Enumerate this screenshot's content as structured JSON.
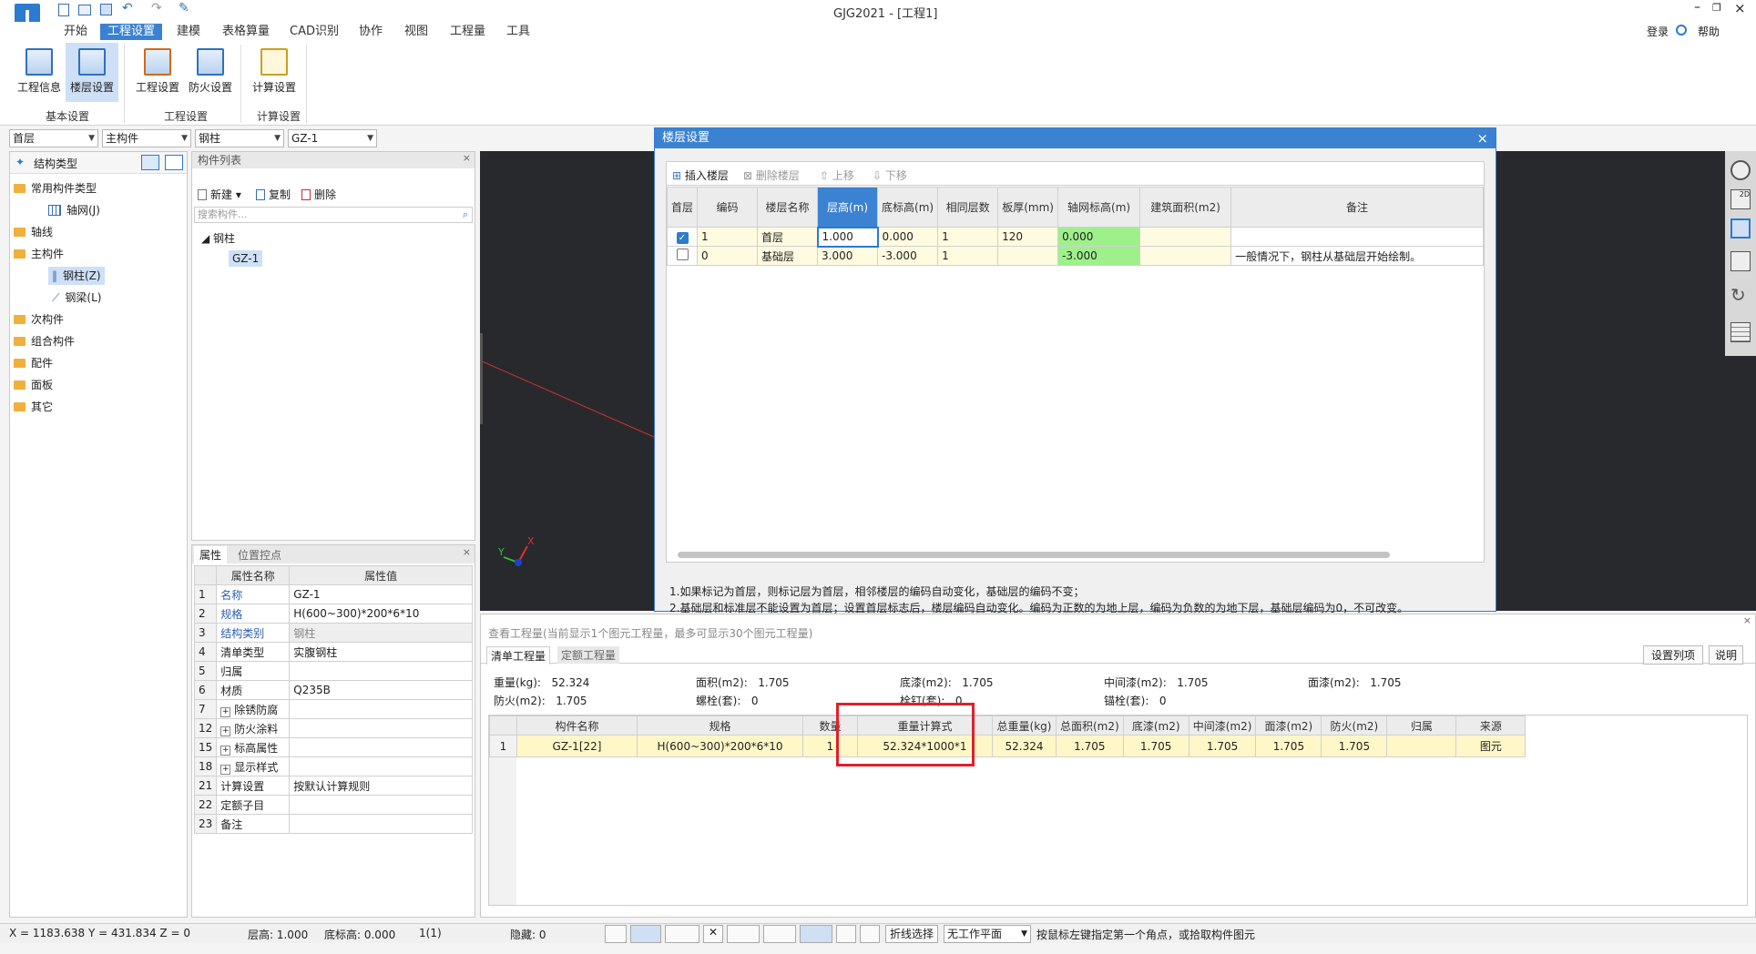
{
  "app": {
    "title": "GJG2021 - [工程1]",
    "login": "登录",
    "help": "帮助"
  },
  "menu": [
    "开始",
    "工程设置",
    "建模",
    "表格算量",
    "CAD识别",
    "协作",
    "视图",
    "工程量",
    "工具"
  ],
  "ribbon": {
    "buttons": [
      "工程信息",
      "楼层设置",
      "工程设置",
      "防火设置",
      "计算设置"
    ],
    "groups": [
      "基本设置",
      "工程设置",
      "计算设置"
    ]
  },
  "selectors": [
    "首层",
    "主构件",
    "钢柱",
    "GZ-1"
  ],
  "structure_panel": {
    "title": "结构类型",
    "items": [
      "常用构件类型",
      "轴网(J)",
      "轴线",
      "主构件",
      "钢柱(Z)",
      "钢梁(L)",
      "次构件",
      "组合构件",
      "配件",
      "面板",
      "其它"
    ]
  },
  "component_list": {
    "title": "构件列表",
    "new": "新建",
    "copy": "复制",
    "delete": "删除",
    "search_placeholder": "搜索构件...",
    "group": "钢柱",
    "item": "GZ-1"
  },
  "properties": {
    "tabs": [
      "属性",
      "位置控点"
    ],
    "headers": [
      "属性名称",
      "属性值"
    ],
    "rows": [
      {
        "n": "1",
        "name": "名称",
        "value": "GZ-1"
      },
      {
        "n": "2",
        "name": "规格",
        "value": "H(600~300)*200*6*10"
      },
      {
        "n": "3",
        "name": "结构类别",
        "value": "钢柱"
      },
      {
        "n": "4",
        "name": "清单类型",
        "value": "实腹钢柱"
      },
      {
        "n": "5",
        "name": "归属",
        "value": ""
      },
      {
        "n": "6",
        "name": "材质",
        "value": "Q235B"
      },
      {
        "n": "7",
        "name": "除锈防腐",
        "value": ""
      },
      {
        "n": "12",
        "name": "防火涂料",
        "value": ""
      },
      {
        "n": "15",
        "name": "标高属性",
        "value": ""
      },
      {
        "n": "18",
        "name": "显示样式",
        "value": ""
      },
      {
        "n": "21",
        "name": "计算设置",
        "value": "按默认计算规则"
      },
      {
        "n": "22",
        "name": "定额子目",
        "value": ""
      },
      {
        "n": "23",
        "name": "备注",
        "value": ""
      }
    ]
  },
  "dialog": {
    "title": "楼层设置",
    "toolbar": [
      "插入楼层",
      "删除楼层",
      "上移",
      "下移"
    ],
    "headers": [
      "首层",
      "编码",
      "楼层名称",
      "层高(m)",
      "底标高(m)",
      "相同层数",
      "板厚(mm)",
      "轴网标高(m)",
      "建筑面积(m2)",
      "备注"
    ],
    "rows": [
      {
        "first": true,
        "code": "1",
        "name": "首层",
        "height": "1.000",
        "bottom": "0.000",
        "same": "1",
        "slab": "120",
        "axis": "0.000",
        "area": "",
        "note": ""
      },
      {
        "first": false,
        "code": "0",
        "name": "基础层",
        "height": "3.000",
        "bottom": "-3.000",
        "same": "1",
        "slab": "",
        "axis": "-3.000",
        "area": "",
        "note": "一般情况下，钢柱从基础层开始绘制。"
      }
    ],
    "notes": [
      "1.如果标记为首层，则标记层为首层，相邻楼层的编码自动变化，基础层的编码不变；",
      "2.基础层和标准层不能设置为首层；设置首层标志后，楼层编码自动变化。编码为正数的为地上层，编码为负数的为地下层，基础层编码为0，不可改变。"
    ]
  },
  "quantity": {
    "header": "查看工程量(当前显示1个图元工程量，最多可显示30个图元工程量)",
    "tabs": [
      "清单工程量",
      "定额工程量"
    ],
    "btn_columns": "设置列项",
    "btn_explain": "说明",
    "summary": [
      [
        {
          "k": "重量(kg):",
          "v": "52.324"
        },
        {
          "k": "面积(m2):",
          "v": "1.705"
        },
        {
          "k": "底漆(m2):",
          "v": "1.705"
        },
        {
          "k": "中间漆(m2):",
          "v": "1.705"
        },
        {
          "k": "面漆(m2):",
          "v": "1.705"
        }
      ],
      [
        {
          "k": "防火(m2):",
          "v": "1.705"
        },
        {
          "k": "螺栓(套):",
          "v": "0"
        },
        {
          "k": "栓钉(套):",
          "v": "0"
        },
        {
          "k": "锚栓(套):",
          "v": "0"
        }
      ]
    ],
    "headers": [
      "构件名称",
      "规格",
      "数量",
      "重量计算式",
      "总重量(kg)",
      "总面积(m2)",
      "底漆(m2)",
      "中间漆(m2)",
      "面漆(m2)",
      "防火(m2)",
      "归属",
      "来源"
    ],
    "rows": [
      [
        "1",
        "GZ-1[22]",
        "H(600~300)*200*6*10",
        "1",
        "52.324*1000*1",
        "52.324",
        "1.705",
        "1.705",
        "1.705",
        "1.705",
        "1.705",
        "",
        "图元"
      ]
    ]
  },
  "status": {
    "coords": "X = 1183.638 Y = 431.834 Z = 0",
    "floor_height": "层高: 1.000",
    "bottom": "底标高: 0.000",
    "count": "1(1)",
    "hidden": "隐藏: 0",
    "polyline": "折线选择",
    "workplane": "无工作平面",
    "hint": "按鼠标左键指定第一个角点，或拾取构件图元"
  },
  "colors": {
    "accent": "#3b82d2",
    "highlight_red": "#e0202a",
    "axis_green": "#9ef08a"
  }
}
